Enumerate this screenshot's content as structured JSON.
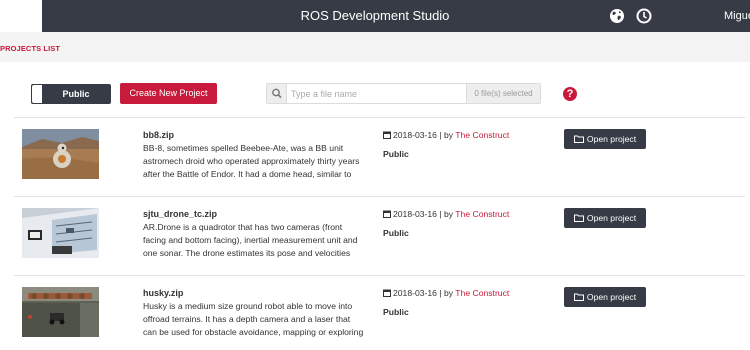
{
  "header": {
    "title": "ROS Development Studio",
    "user": "Miguel",
    "icons": [
      "globe-icon",
      "clock-icon"
    ]
  },
  "breadcrumb": "PROJECTS LIST",
  "toolbar": {
    "toggle_label": "Public",
    "create_label": "Create New Project",
    "search_placeholder": "Type a file name",
    "files_selected": "0 file(s) selected",
    "help_label": "?"
  },
  "projects": [
    {
      "name": "bb8.zip",
      "description": "BB-8, sometimes spelled Beebee-Ate, was a BB unit astromech droid who operated approximately thirty years after the Battle of Endor. It had a dome head, similar to",
      "date": "2018-03-16",
      "by": "| by",
      "author": "The Construct",
      "visibility": "Public",
      "open_label": "Open project"
    },
    {
      "name": "sjtu_drone_tc.zip",
      "description": "AR.Drone is a quadrotor that has two cameras (front facing and bottom facing), inertial measurement unit and one sonar. The drone estimates its pose and velocities",
      "date": "2018-03-16",
      "by": "| by",
      "author": "The Construct",
      "visibility": "Public",
      "open_label": "Open project"
    },
    {
      "name": "husky.zip",
      "description": "Husky is a medium size ground robot able to move into offroad terrains. It has a depth camera and a laser that can be used for obstacle avoidance, mapping or exploring",
      "date": "2018-03-16",
      "by": "| by",
      "author": "The Construct",
      "visibility": "Public",
      "open_label": "Open project"
    }
  ],
  "colors": {
    "header_bg": "#363b45",
    "accent": "#c81a3a",
    "strip_bg": "#f4f4f4"
  }
}
